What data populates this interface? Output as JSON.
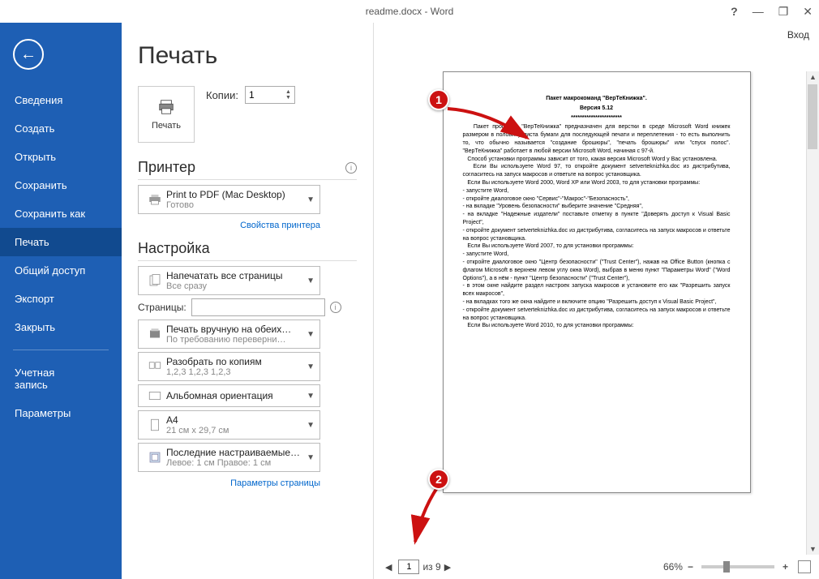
{
  "titlebar": {
    "title": "readme.docx - Word",
    "login": "Вход"
  },
  "sidebar": {
    "items": [
      "Сведения",
      "Создать",
      "Открыть",
      "Сохранить",
      "Сохранить как",
      "Печать",
      "Общий доступ",
      "Экспорт",
      "Закрыть"
    ],
    "account": "Учетная\nзапись",
    "params": "Параметры",
    "active_index": 5
  },
  "print": {
    "title": "Печать",
    "button_label": "Печать",
    "copies_label": "Копии:",
    "copies_value": "1"
  },
  "printer": {
    "section": "Принтер",
    "name": "Print to PDF (Mac Desktop)",
    "status": "Готово",
    "props_link": "Свойства принтера"
  },
  "settings": {
    "section": "Настройка",
    "scope": {
      "primary": "Напечатать все страницы",
      "secondary": "Все сразу"
    },
    "pages_label": "Страницы:",
    "pages_value": "",
    "duplex": {
      "primary": "Печать вручную на обеих…",
      "secondary": "По требованию переверни…"
    },
    "collate": {
      "primary": "Разобрать по копиям",
      "secondary": "1,2,3   1,2,3   1,2,3"
    },
    "orient": {
      "primary": "Альбомная ориентация",
      "secondary": ""
    },
    "paper": {
      "primary": "A4",
      "secondary": "21 см x 29,7 см"
    },
    "margins": {
      "primary": "Последние настраиваемые…",
      "secondary": "Левое: 1 см   Правое: 1 см"
    },
    "page_params_link": "Параметры страницы"
  },
  "preview": {
    "title1": "Пакет макрокоманд \"ВерТеКнижка\".",
    "title2": "Версия 5.12",
    "stars": "***********************",
    "body": "   Пакет программ \"ВерТеКнижка\" предназначен для верстки в среде Microsoft Word книжек размером в половину листа бумаги для последующей печати и переплетения - то есть выполнить то, что обычно называется \"создание брошюры\", \"печать брошюры\" или \"спуск полос\". \"ВерТеКнижка\" работает в любой версии Microsoft Word, начиная с 97-й.\n   Способ установки программы зависит от того, какая версия Microsoft Word у Вас установлена.\n   Если Вы используете Word 97, то откройте документ setverteknizhka.doc из дистрибутива, согласитесь на запуск макросов и ответьте на вопрос установщика.\n   Если Вы используете Word 2000, Word XP или Word 2003, то для установки программы:\n- запустите Word,\n- откройте диалоговое окно \"Сервис\"-\"Макрос\"-\"Безопасность\",\n- на вкладке \"Уровень безопасности\" выберите значение \"Средняя\",\n- на вкладке \"Надежные издатели\" поставьте отметку в пункте \"Доверять доступ к Visual Basic Project\",\n- откройте документ setverteknizhka.doc из дистрибутива, согласитесь на запуск макросов и ответьте на вопрос установщика.\n   Если Вы используете Word 2007, то для установки программы:\n- запустите Word,\n- откройте диалоговое окно \"Центр безопасности\" (\"Trust Center\"), нажав на Office Button (кнопка с флагом Microsoft в верхнем левом углу окна Word), выбрав в меню пункт \"Параметры Word\" (\"Word Options\"), а в нём - пункт \"Центр безопасности\" (\"Trust Center\"),\n- в этом окне найдите раздел настроек запуска макросов и установите его как \"Разрешить запуск всех макросов\",\n- на вкладках того же окна найдите и включите опцию \"Разрешить доступ к Visual Basic Project\",\n- откройте документ setverteknizhka.doc из дистрибутива, согласитесь на запуск макросов и ответьте на вопрос установщика.\n   Если Вы используете Word 2010, то для установки программы:",
    "page_current": "1",
    "page_total_label": "из 9",
    "zoom": "66%"
  },
  "annotations": {
    "marker1": "1",
    "marker2": "2"
  }
}
